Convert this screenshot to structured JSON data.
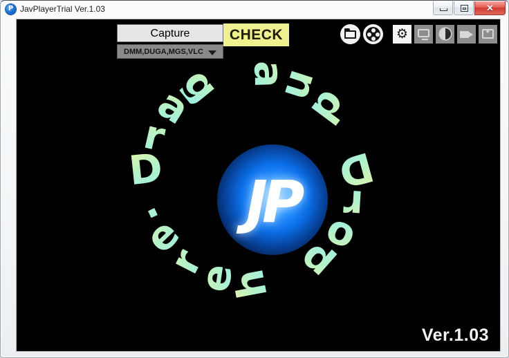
{
  "window": {
    "title": "JavPlayerTrial Ver.1.03",
    "app_icon": "app-logo-icon",
    "icon_letter": "P",
    "controls": {
      "minimize_label": "–",
      "maximize_label": "□",
      "close_label": "✕"
    }
  },
  "toolbar": {
    "capture_label": "Capture",
    "site_select_value": "DMM,DUGA,MGS,VLC",
    "check_label": "CHECK",
    "icons": [
      {
        "name": "open-folder-icon",
        "shape": "circle"
      },
      {
        "name": "film-reel-icon",
        "shape": "circle"
      },
      {
        "name": "settings-gear-icon",
        "shape": "square",
        "active": true
      },
      {
        "name": "monitor-display-icon",
        "shape": "square",
        "active": false
      },
      {
        "name": "brightness-contrast-icon",
        "shape": "square",
        "active": false
      },
      {
        "name": "camcorder-record-icon",
        "shape": "square",
        "active": false
      },
      {
        "name": "add-image-effect-icon",
        "shape": "square",
        "active": false
      }
    ]
  },
  "dropzone": {
    "ring_text": "Drag and Drop here.",
    "logo_text": "JP",
    "gradient_start": "#e2f5a9",
    "gradient_end": "#9af0e6",
    "glow_color": "#0b6fe8"
  },
  "footer": {
    "version_label": "Ver.1.03"
  },
  "colors": {
    "client_background": "#000000",
    "check_button": "#eff08f",
    "capture_button": "#e6e6e6",
    "select_button": "#8a8a8a",
    "titlebar": "#fbfbfb",
    "close_button": "#cf3a30"
  }
}
